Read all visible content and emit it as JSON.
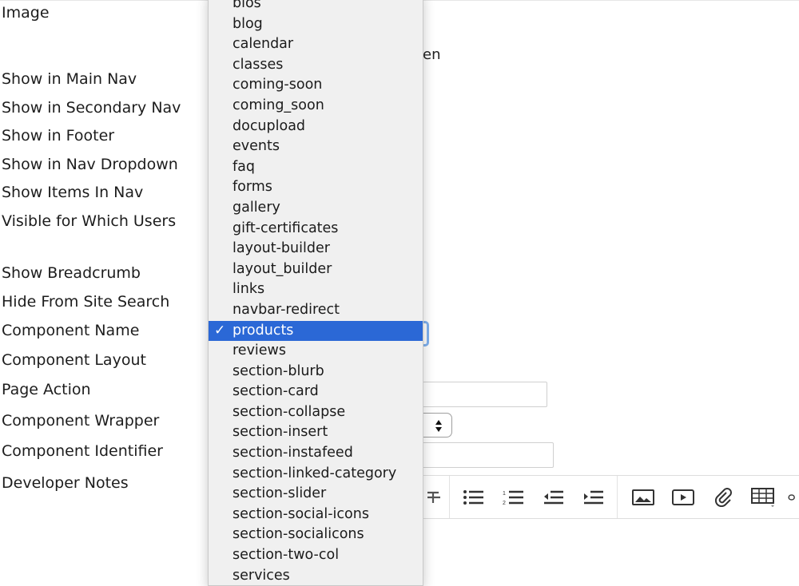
{
  "form": {
    "labels": {
      "image": "Image",
      "show_main_nav": "Show in Main Nav",
      "show_secondary_nav": "Show in Secondary Nav",
      "show_footer": "Show in Footer",
      "show_nav_dropdown": "Show in Nav Dropdown",
      "show_items_in_nav": "Show Items In Nav",
      "visible_users": "Visible for Which Users",
      "show_breadcrumb": "Show Breadcrumb",
      "hide_site_search": "Hide From Site Search",
      "component_name": "Component Name",
      "component_layout": "Component Layout",
      "page_action": "Page Action",
      "component_wrapper": "Component Wrapper",
      "component_identifier": "Component Identifier",
      "developer_notes": "Developer Notes"
    },
    "partial_text": "en"
  },
  "dropdown": {
    "selected": "products",
    "check": "✓",
    "options": [
      "bios",
      "blog",
      "calendar",
      "classes",
      "coming-soon",
      "coming_soon",
      "docupload",
      "events",
      "faq",
      "forms",
      "gallery",
      "gift-certificates",
      "layout-builder",
      "layout_builder",
      "links",
      "navbar-redirect",
      "products",
      "reviews",
      "section-blurb",
      "section-card",
      "section-collapse",
      "section-insert",
      "section-instafeed",
      "section-linked-category",
      "section-slider",
      "section-social-icons",
      "section-socialicons",
      "section-two-col",
      "services"
    ]
  },
  "toolbar": {
    "icons": [
      "strikethrough-icon",
      "bullet-list-icon",
      "numbered-list-icon",
      "outdent-icon",
      "indent-icon",
      "image-icon",
      "video-icon",
      "attachment-icon",
      "table-icon",
      "link-icon"
    ]
  }
}
